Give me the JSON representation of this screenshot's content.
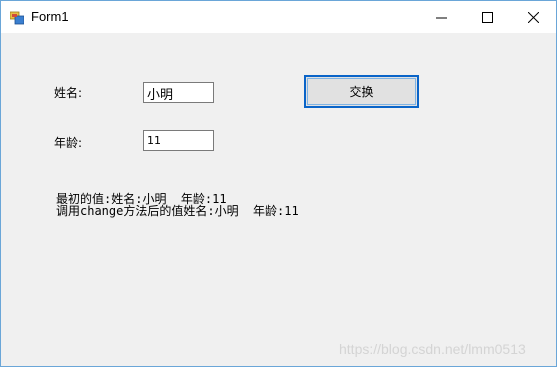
{
  "window": {
    "title": "Form1"
  },
  "form": {
    "name_label": "姓名:",
    "name_value": "小明",
    "age_label": "年龄:",
    "age_value": "11",
    "swap_button": "交换",
    "result_line1": "最初的值:姓名:小明  年龄:11",
    "result_line2": "调用change方法后的值姓名:小明  年龄:11"
  },
  "watermark": "https://blog.csdn.net/lmm0513"
}
